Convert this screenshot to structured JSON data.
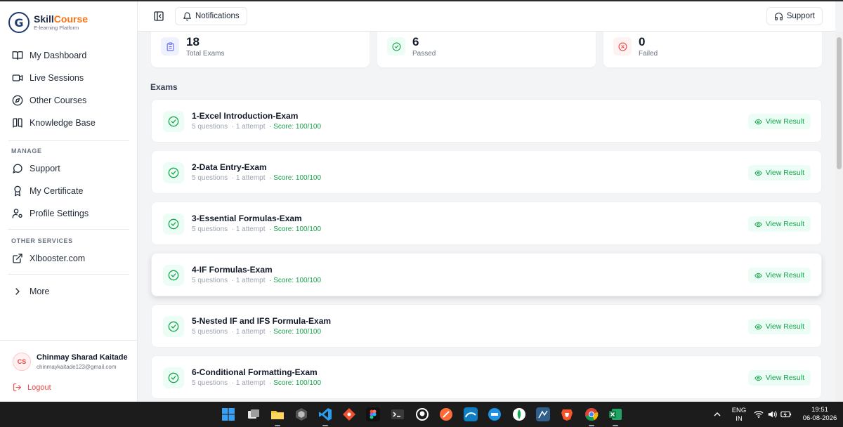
{
  "brand": {
    "name_part1": "Skill",
    "name_part2": "Course",
    "subtitle": "E-learning Platform",
    "logo_letter": "G"
  },
  "sidebar": {
    "items": [
      {
        "label": "My Dashboard",
        "icon": "dashboard-icon"
      },
      {
        "label": "Live Sessions",
        "icon": "video-icon"
      },
      {
        "label": "Other Courses",
        "icon": "compass-icon"
      },
      {
        "label": "Knowledge Base",
        "icon": "book-icon"
      }
    ],
    "manage_label": "MANAGE",
    "manage_items": [
      {
        "label": "Support",
        "icon": "chat-icon"
      },
      {
        "label": "My Certificate",
        "icon": "award-icon"
      },
      {
        "label": "Profile Settings",
        "icon": "user-settings-icon"
      }
    ],
    "other_label": "OTHER SERVICES",
    "other_items": [
      {
        "label": "Xlbooster.com",
        "icon": "external-link-icon"
      }
    ],
    "more_label": "More"
  },
  "user": {
    "initials": "CS",
    "name": "Chinmay Sharad Kaitade",
    "email": "chinmaykaitade123@gmail.com",
    "logout_label": "Logout"
  },
  "header": {
    "notifications_label": "Notifications",
    "support_label": "Support"
  },
  "stats": [
    {
      "value": "18",
      "label": "Total Exams",
      "icon": "clipboard-icon",
      "color": "#6366f1",
      "bg": "#eef2ff"
    },
    {
      "value": "6",
      "label": "Passed",
      "icon": "check-circle-icon",
      "color": "#16a34a",
      "bg": "#ecfdf5"
    },
    {
      "value": "0",
      "label": "Failed",
      "icon": "x-circle-icon",
      "color": "#ef4444",
      "bg": "#fef2f2"
    }
  ],
  "exams_title": "Exams",
  "exams": [
    {
      "title": "1-Excel Introduction-Exam",
      "questions": "5 questions",
      "attempts": "· 1 attempt",
      "score": "· Score: 100/100",
      "action": "View Result"
    },
    {
      "title": "2-Data Entry-Exam",
      "questions": "5 questions",
      "attempts": "· 1 attempt",
      "score": "· Score: 100/100",
      "action": "View Result"
    },
    {
      "title": "3-Essential Formulas-Exam",
      "questions": "5 questions",
      "attempts": "· 1 attempt",
      "score": "· Score: 100/100",
      "action": "View Result"
    },
    {
      "title": "4-IF Formulas-Exam",
      "questions": "5 questions",
      "attempts": "· 1 attempt",
      "score": "· Score: 100/100",
      "action": "View Result"
    },
    {
      "title": "5-Nested IF and IFS Formula-Exam",
      "questions": "5 questions",
      "attempts": "· 1 attempt",
      "score": "· Score: 100/100",
      "action": "View Result"
    },
    {
      "title": "6-Conditional Formatting-Exam",
      "questions": "5 questions",
      "attempts": "· 1 attempt",
      "score": "· Score: 100/100",
      "action": "View Result"
    }
  ],
  "taskbar": {
    "lang_line1": "ENG",
    "lang_line2": "IN",
    "time": "19:51",
    "date": "06-08-2026"
  },
  "colors": {
    "accent_green": "#16a34a",
    "brand_orange": "#f97316",
    "brand_navy": "#1f3b73",
    "danger": "#ef4444"
  }
}
